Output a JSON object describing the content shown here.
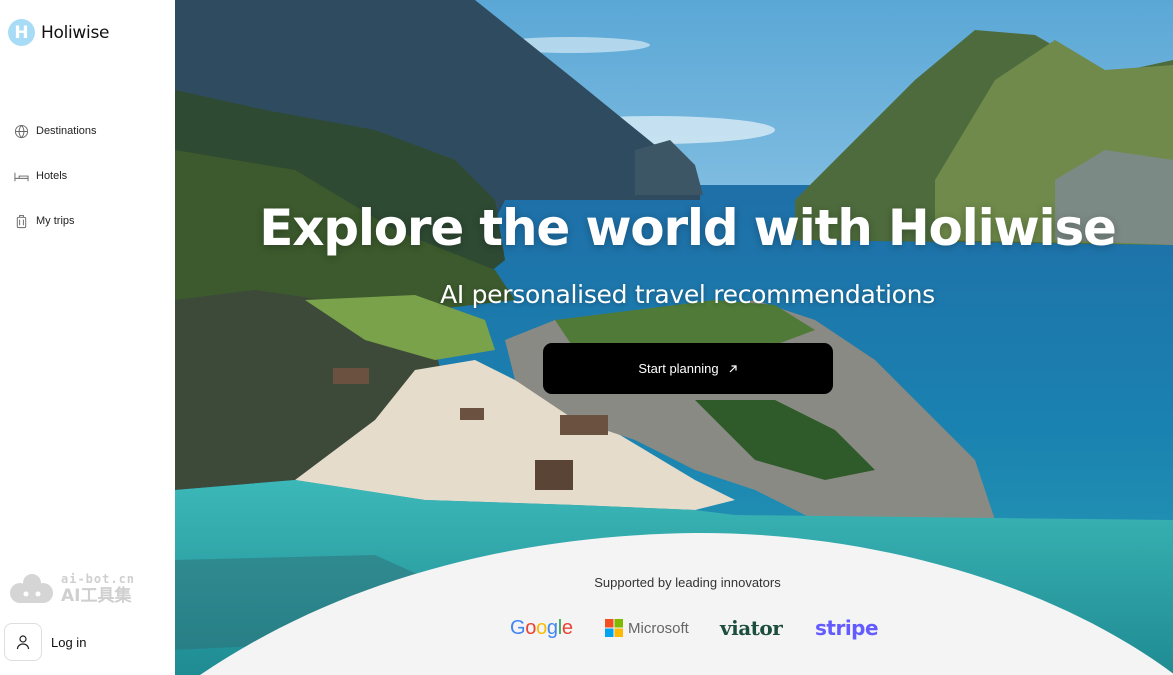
{
  "brand": {
    "initial": "H",
    "name": "Holiwise"
  },
  "sidebar": {
    "items": [
      {
        "label": "Destinations",
        "icon": "globe-icon"
      },
      {
        "label": "Hotels",
        "icon": "bed-icon"
      },
      {
        "label": "My trips",
        "icon": "luggage-icon"
      }
    ],
    "login_label": "Log in",
    "login_icon": "user-icon"
  },
  "watermark": {
    "url": "ai-bot.cn",
    "text": "AI工具集"
  },
  "hero": {
    "title": "Explore the world with Holiwise",
    "subtitle": "AI personalised travel recommendations",
    "cta_label": "Start planning",
    "cta_icon": "arrow-up-right-icon"
  },
  "partners": {
    "heading": "Supported by leading innovators",
    "google": [
      "G",
      "o",
      "o",
      "g",
      "l",
      "e"
    ],
    "microsoft": "Microsoft",
    "viator": "viator",
    "stripe": "stripe"
  },
  "colors": {
    "brand_accent": "#a8dcf6",
    "cta_background": "#000000",
    "stripe": "#635bff",
    "viator": "#1c4d3d"
  }
}
